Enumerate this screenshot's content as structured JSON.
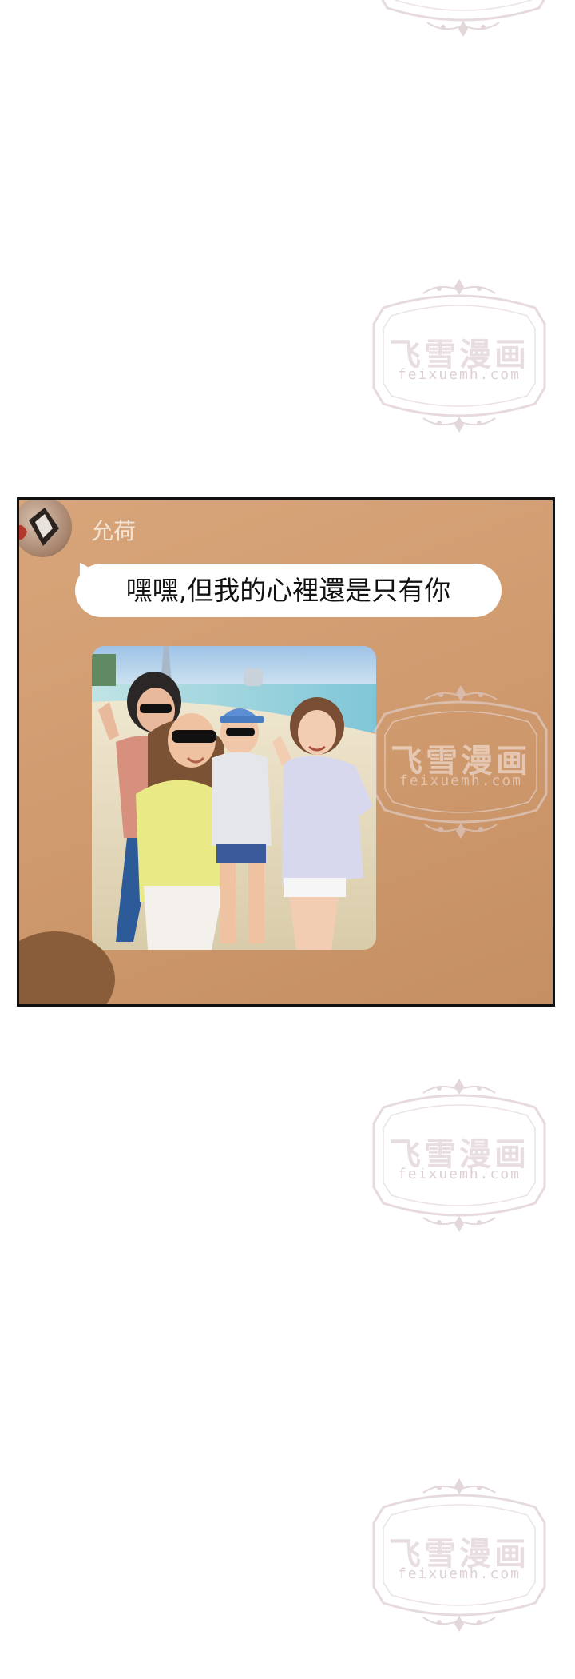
{
  "watermark": {
    "title": "飞雪漫画",
    "url": "feixuemh.com"
  },
  "chat": {
    "sender_name": "允荷",
    "message": "嘿嘿,但我的心裡還是只有你",
    "photo_description": "beach-selfie-photo"
  },
  "colors": {
    "panel_bg": "#cf9a6e",
    "bubble_bg": "#ffffff",
    "watermark": "#e3d7da"
  }
}
